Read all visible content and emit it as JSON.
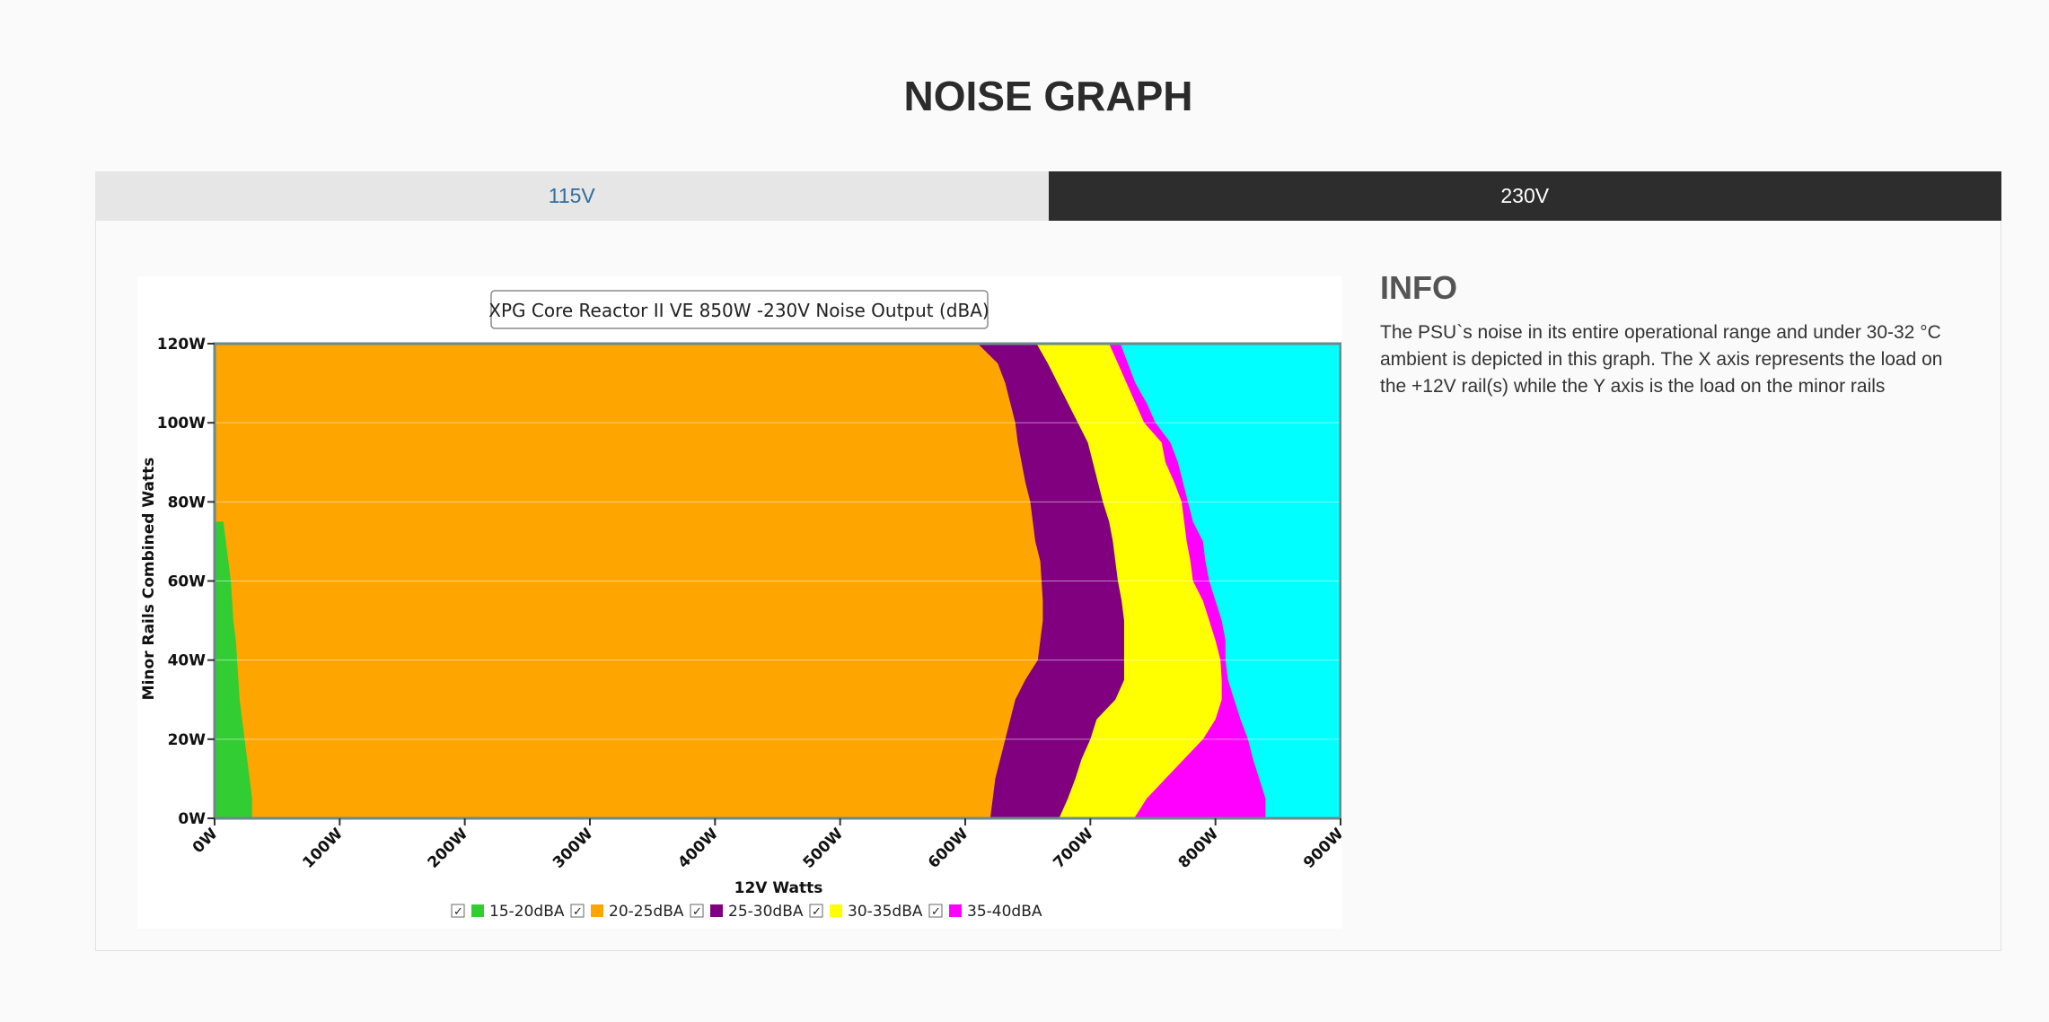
{
  "page": {
    "title": "NOISE GRAPH"
  },
  "tabs": [
    {
      "label": "115V",
      "active": false
    },
    {
      "label": "230V",
      "active": true
    }
  ],
  "info": {
    "heading": "INFO",
    "text": "The PSU`s noise in its entire operational range and under 30-32 °C ambient is depicted in this graph. The X axis represents the load on the +12V rail(s) while the Y axis is the load on the minor rails"
  },
  "colors": {
    "15-20dBA": "#32cd32",
    "20-25dBA": "#ffa500",
    "25-30dBA": "#800080",
    "30-35dBA": "#ffff00",
    "35-40dBA": "#ff00ff",
    "above": "#00ffff"
  },
  "chart_data": {
    "type": "heatmap",
    "title": "XPG Core Reactor II VE 850W -230V Noise Output (dBA)",
    "xlabel": "12V Watts",
    "ylabel": "Minor Rails Combined Watts",
    "xlim": [
      0,
      900
    ],
    "ylim": [
      0,
      120
    ],
    "x_ticks": [
      "0W",
      "100W",
      "200W",
      "300W",
      "400W",
      "500W",
      "600W",
      "700W",
      "800W",
      "900W"
    ],
    "y_ticks": [
      "0W",
      "20W",
      "40W",
      "60W",
      "80W",
      "100W",
      "120W"
    ],
    "grid": true,
    "legend_position": "bottom",
    "legend": [
      "15-20dBA",
      "20-25dBA",
      "25-30dBA",
      "30-35dBA",
      "35-40dBA"
    ],
    "y_samples": [
      0,
      5,
      10,
      15,
      20,
      25,
      30,
      35,
      40,
      45,
      50,
      55,
      60,
      65,
      70,
      75,
      80,
      85,
      90,
      95,
      100,
      105,
      110,
      115,
      120
    ],
    "boundaries": [
      {
        "name": "15-20dBA",
        "upper_x": [
          30,
          30,
          28,
          26,
          24,
          22,
          20,
          19,
          18,
          17,
          15,
          14,
          13,
          11,
          9,
          7,
          5,
          5,
          5,
          5,
          5,
          5,
          5,
          5,
          5
        ],
        "active_to_y": 75
      },
      {
        "name": "20-25dBA",
        "upper_x": [
          620,
          622,
          624,
          628,
          632,
          636,
          640,
          648,
          658,
          660,
          662,
          662,
          661,
          660,
          656,
          654,
          652,
          648,
          645,
          642,
          640,
          636,
          632,
          626,
          610
        ]
      },
      {
        "name": "25-30dBA",
        "upper_x": [
          675,
          682,
          688,
          693,
          700,
          705,
          720,
          727,
          727,
          727,
          727,
          725,
          722,
          720,
          718,
          715,
          710,
          706,
          702,
          698,
          690,
          682,
          674,
          666,
          657
        ]
      },
      {
        "name": "30-35dBA",
        "upper_x": [
          735,
          745,
          760,
          775,
          790,
          800,
          805,
          805,
          804,
          800,
          795,
          790,
          782,
          780,
          777,
          775,
          773,
          767,
          760,
          757,
          743,
          736,
          729,
          722,
          715
        ]
      },
      {
        "name": "35-40dBA",
        "upper_x": [
          840,
          840,
          835,
          830,
          826,
          820,
          815,
          810,
          808,
          808,
          805,
          800,
          795,
          792,
          790,
          782,
          778,
          774,
          770,
          764,
          752,
          745,
          736,
          730,
          724
        ]
      }
    ],
    "above_max_color": "#00ffff"
  }
}
